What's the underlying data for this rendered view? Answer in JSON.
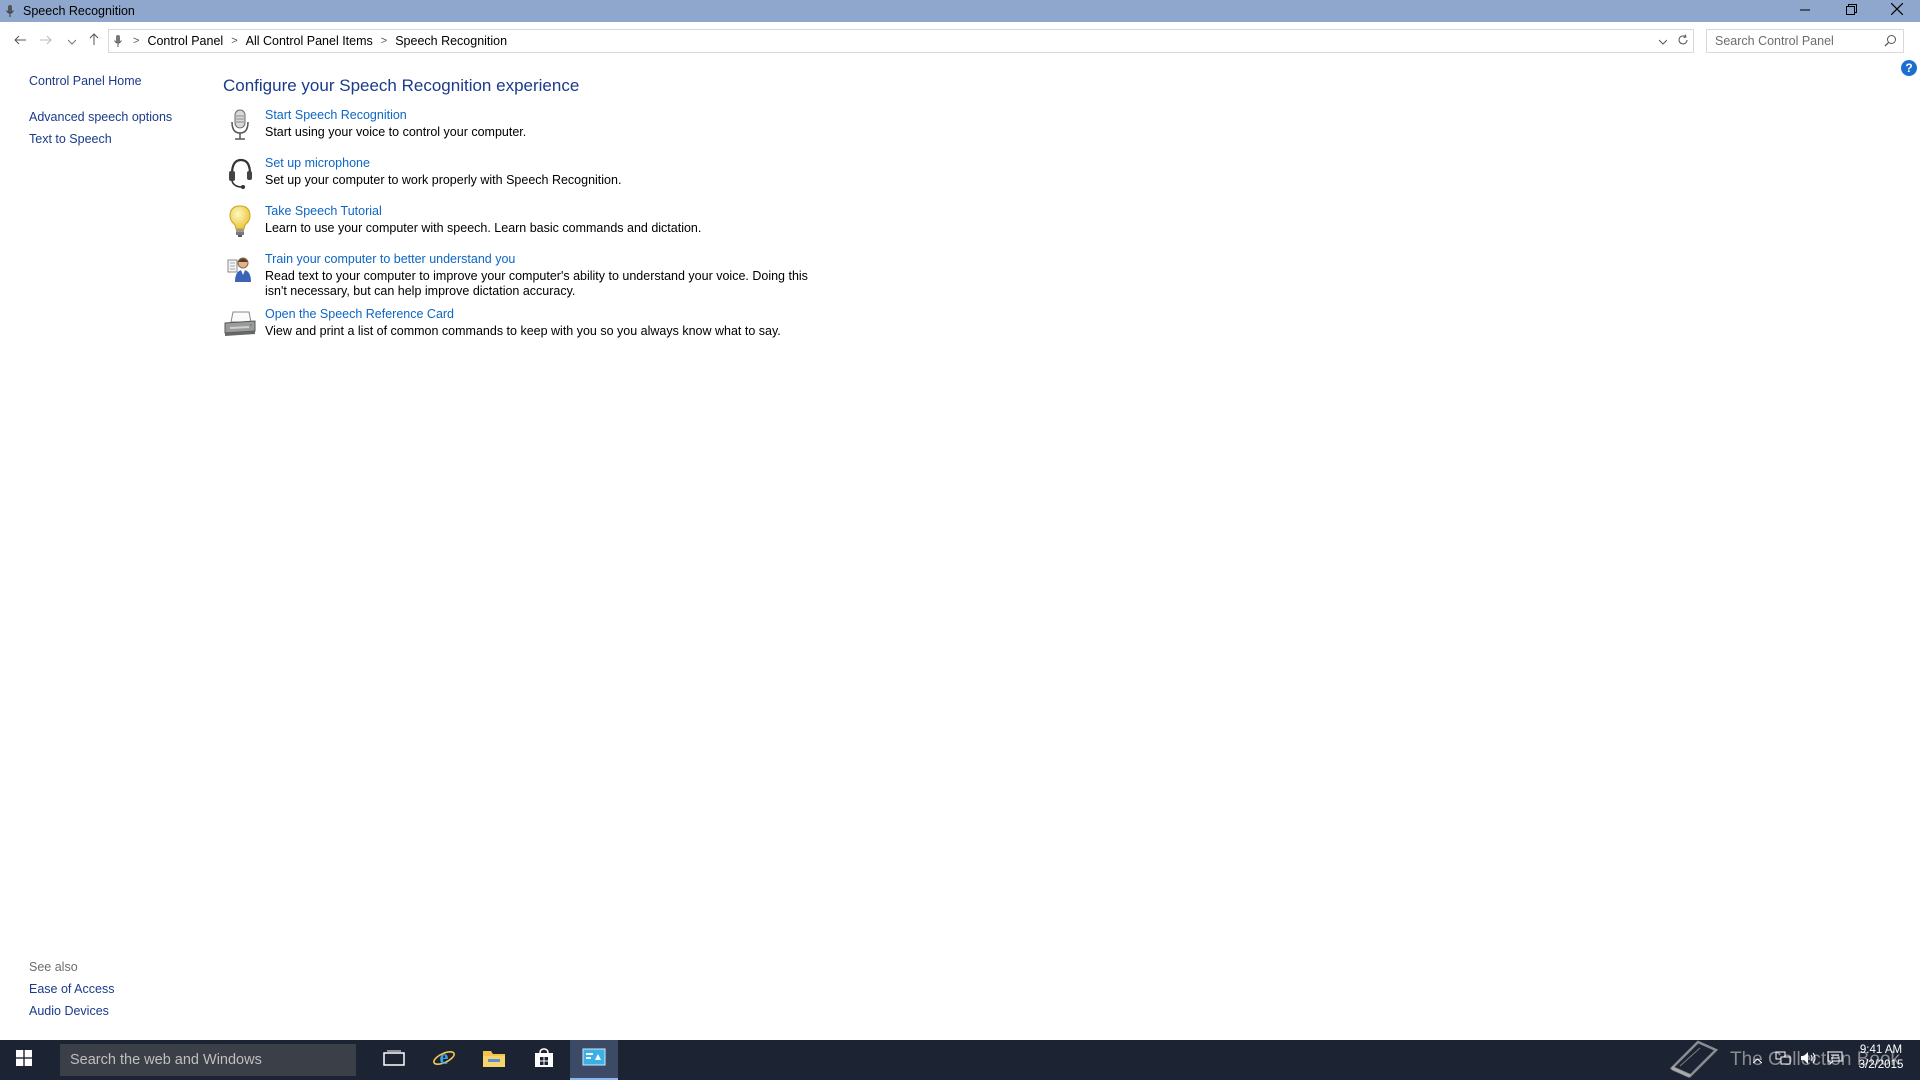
{
  "window": {
    "title": "Speech Recognition",
    "controls": {
      "minimize": "minimize-icon",
      "restore": "restore-icon",
      "close": "close-icon"
    }
  },
  "address": {
    "breadcrumbs": [
      "Control Panel",
      "All Control Panel Items",
      "Speech Recognition"
    ],
    "search_placeholder": "Search Control Panel"
  },
  "left_pane": {
    "home": "Control Panel Home",
    "items": [
      "Advanced speech options",
      "Text to Speech"
    ]
  },
  "see_also": {
    "heading": "See also",
    "items": [
      "Ease of Access",
      "Audio Devices"
    ]
  },
  "main": {
    "title": "Configure your Speech Recognition experience",
    "tasks": [
      {
        "link": "Start Speech Recognition",
        "desc": "Start using your voice to control your computer.",
        "icon": "microphone-icon"
      },
      {
        "link": "Set up microphone",
        "desc": "Set up your computer to work properly with Speech Recognition.",
        "icon": "headset-icon"
      },
      {
        "link": "Take Speech Tutorial",
        "desc": "Learn to use your computer with speech.  Learn basic commands and dictation.",
        "icon": "lightbulb-icon"
      },
      {
        "link": "Train your computer to better understand you",
        "desc": "Read text to your computer to improve your computer's ability to understand your voice.  Doing this isn't necessary, but can help improve dictation accuracy.",
        "icon": "user-training-icon"
      },
      {
        "link": "Open the Speech Reference Card",
        "desc": "View and print a list of common commands to keep with you so you always know what to say.",
        "icon": "printer-icon"
      }
    ]
  },
  "taskbar": {
    "search_placeholder": "Search the web and Windows",
    "watermark": "The Collection Book",
    "clock": {
      "time": "9:41 AM",
      "date": "3/2/2015"
    }
  },
  "colors": {
    "titlebar": "#8fa7cc",
    "link": "#0e66c4",
    "heading": "#1a3a8b",
    "taskbar": "#1c2333"
  }
}
